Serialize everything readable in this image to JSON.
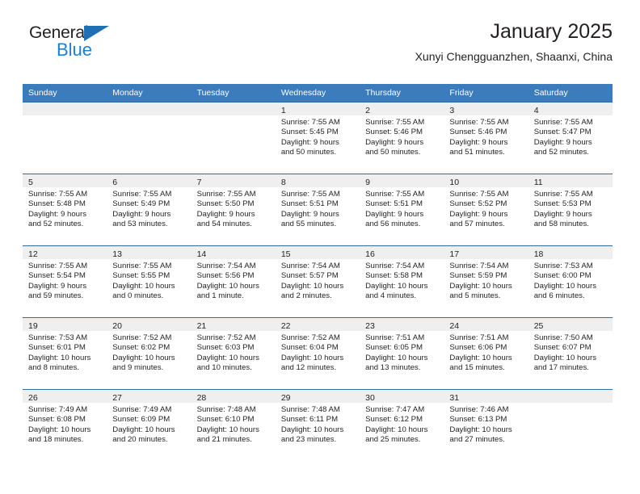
{
  "brand": {
    "name_part1": "General",
    "name_part2": "Blue",
    "triangle_color": "#1f6fb4",
    "blue_color": "#1f80d0"
  },
  "header": {
    "title": "January 2025",
    "subtitle": "Xunyi Chengguanzhen, Shaanxi, China"
  },
  "theme": {
    "header_bg": "#3c7cbd",
    "row_divider": "#2e6da4",
    "daynum_band_bg": "#efefef",
    "text": "#231f20"
  },
  "weekdays": [
    "Sunday",
    "Monday",
    "Tuesday",
    "Wednesday",
    "Thursday",
    "Friday",
    "Saturday"
  ],
  "weeks": [
    [
      {
        "day": "",
        "sunrise": "",
        "sunset": "",
        "daylight1": "",
        "daylight2": ""
      },
      {
        "day": "",
        "sunrise": "",
        "sunset": "",
        "daylight1": "",
        "daylight2": ""
      },
      {
        "day": "",
        "sunrise": "",
        "sunset": "",
        "daylight1": "",
        "daylight2": ""
      },
      {
        "day": "1",
        "sunrise": "Sunrise: 7:55 AM",
        "sunset": "Sunset: 5:45 PM",
        "daylight1": "Daylight: 9 hours",
        "daylight2": "and 50 minutes."
      },
      {
        "day": "2",
        "sunrise": "Sunrise: 7:55 AM",
        "sunset": "Sunset: 5:46 PM",
        "daylight1": "Daylight: 9 hours",
        "daylight2": "and 50 minutes."
      },
      {
        "day": "3",
        "sunrise": "Sunrise: 7:55 AM",
        "sunset": "Sunset: 5:46 PM",
        "daylight1": "Daylight: 9 hours",
        "daylight2": "and 51 minutes."
      },
      {
        "day": "4",
        "sunrise": "Sunrise: 7:55 AM",
        "sunset": "Sunset: 5:47 PM",
        "daylight1": "Daylight: 9 hours",
        "daylight2": "and 52 minutes."
      }
    ],
    [
      {
        "day": "5",
        "sunrise": "Sunrise: 7:55 AM",
        "sunset": "Sunset: 5:48 PM",
        "daylight1": "Daylight: 9 hours",
        "daylight2": "and 52 minutes."
      },
      {
        "day": "6",
        "sunrise": "Sunrise: 7:55 AM",
        "sunset": "Sunset: 5:49 PM",
        "daylight1": "Daylight: 9 hours",
        "daylight2": "and 53 minutes."
      },
      {
        "day": "7",
        "sunrise": "Sunrise: 7:55 AM",
        "sunset": "Sunset: 5:50 PM",
        "daylight1": "Daylight: 9 hours",
        "daylight2": "and 54 minutes."
      },
      {
        "day": "8",
        "sunrise": "Sunrise: 7:55 AM",
        "sunset": "Sunset: 5:51 PM",
        "daylight1": "Daylight: 9 hours",
        "daylight2": "and 55 minutes."
      },
      {
        "day": "9",
        "sunrise": "Sunrise: 7:55 AM",
        "sunset": "Sunset: 5:51 PM",
        "daylight1": "Daylight: 9 hours",
        "daylight2": "and 56 minutes."
      },
      {
        "day": "10",
        "sunrise": "Sunrise: 7:55 AM",
        "sunset": "Sunset: 5:52 PM",
        "daylight1": "Daylight: 9 hours",
        "daylight2": "and 57 minutes."
      },
      {
        "day": "11",
        "sunrise": "Sunrise: 7:55 AM",
        "sunset": "Sunset: 5:53 PM",
        "daylight1": "Daylight: 9 hours",
        "daylight2": "and 58 minutes."
      }
    ],
    [
      {
        "day": "12",
        "sunrise": "Sunrise: 7:55 AM",
        "sunset": "Sunset: 5:54 PM",
        "daylight1": "Daylight: 9 hours",
        "daylight2": "and 59 minutes."
      },
      {
        "day": "13",
        "sunrise": "Sunrise: 7:55 AM",
        "sunset": "Sunset: 5:55 PM",
        "daylight1": "Daylight: 10 hours",
        "daylight2": "and 0 minutes."
      },
      {
        "day": "14",
        "sunrise": "Sunrise: 7:54 AM",
        "sunset": "Sunset: 5:56 PM",
        "daylight1": "Daylight: 10 hours",
        "daylight2": "and 1 minute."
      },
      {
        "day": "15",
        "sunrise": "Sunrise: 7:54 AM",
        "sunset": "Sunset: 5:57 PM",
        "daylight1": "Daylight: 10 hours",
        "daylight2": "and 2 minutes."
      },
      {
        "day": "16",
        "sunrise": "Sunrise: 7:54 AM",
        "sunset": "Sunset: 5:58 PM",
        "daylight1": "Daylight: 10 hours",
        "daylight2": "and 4 minutes."
      },
      {
        "day": "17",
        "sunrise": "Sunrise: 7:54 AM",
        "sunset": "Sunset: 5:59 PM",
        "daylight1": "Daylight: 10 hours",
        "daylight2": "and 5 minutes."
      },
      {
        "day": "18",
        "sunrise": "Sunrise: 7:53 AM",
        "sunset": "Sunset: 6:00 PM",
        "daylight1": "Daylight: 10 hours",
        "daylight2": "and 6 minutes."
      }
    ],
    [
      {
        "day": "19",
        "sunrise": "Sunrise: 7:53 AM",
        "sunset": "Sunset: 6:01 PM",
        "daylight1": "Daylight: 10 hours",
        "daylight2": "and 8 minutes."
      },
      {
        "day": "20",
        "sunrise": "Sunrise: 7:52 AM",
        "sunset": "Sunset: 6:02 PM",
        "daylight1": "Daylight: 10 hours",
        "daylight2": "and 9 minutes."
      },
      {
        "day": "21",
        "sunrise": "Sunrise: 7:52 AM",
        "sunset": "Sunset: 6:03 PM",
        "daylight1": "Daylight: 10 hours",
        "daylight2": "and 10 minutes."
      },
      {
        "day": "22",
        "sunrise": "Sunrise: 7:52 AM",
        "sunset": "Sunset: 6:04 PM",
        "daylight1": "Daylight: 10 hours",
        "daylight2": "and 12 minutes."
      },
      {
        "day": "23",
        "sunrise": "Sunrise: 7:51 AM",
        "sunset": "Sunset: 6:05 PM",
        "daylight1": "Daylight: 10 hours",
        "daylight2": "and 13 minutes."
      },
      {
        "day": "24",
        "sunrise": "Sunrise: 7:51 AM",
        "sunset": "Sunset: 6:06 PM",
        "daylight1": "Daylight: 10 hours",
        "daylight2": "and 15 minutes."
      },
      {
        "day": "25",
        "sunrise": "Sunrise: 7:50 AM",
        "sunset": "Sunset: 6:07 PM",
        "daylight1": "Daylight: 10 hours",
        "daylight2": "and 17 minutes."
      }
    ],
    [
      {
        "day": "26",
        "sunrise": "Sunrise: 7:49 AM",
        "sunset": "Sunset: 6:08 PM",
        "daylight1": "Daylight: 10 hours",
        "daylight2": "and 18 minutes."
      },
      {
        "day": "27",
        "sunrise": "Sunrise: 7:49 AM",
        "sunset": "Sunset: 6:09 PM",
        "daylight1": "Daylight: 10 hours",
        "daylight2": "and 20 minutes."
      },
      {
        "day": "28",
        "sunrise": "Sunrise: 7:48 AM",
        "sunset": "Sunset: 6:10 PM",
        "daylight1": "Daylight: 10 hours",
        "daylight2": "and 21 minutes."
      },
      {
        "day": "29",
        "sunrise": "Sunrise: 7:48 AM",
        "sunset": "Sunset: 6:11 PM",
        "daylight1": "Daylight: 10 hours",
        "daylight2": "and 23 minutes."
      },
      {
        "day": "30",
        "sunrise": "Sunrise: 7:47 AM",
        "sunset": "Sunset: 6:12 PM",
        "daylight1": "Daylight: 10 hours",
        "daylight2": "and 25 minutes."
      },
      {
        "day": "31",
        "sunrise": "Sunrise: 7:46 AM",
        "sunset": "Sunset: 6:13 PM",
        "daylight1": "Daylight: 10 hours",
        "daylight2": "and 27 minutes."
      },
      {
        "day": "",
        "sunrise": "",
        "sunset": "",
        "daylight1": "",
        "daylight2": ""
      }
    ]
  ]
}
